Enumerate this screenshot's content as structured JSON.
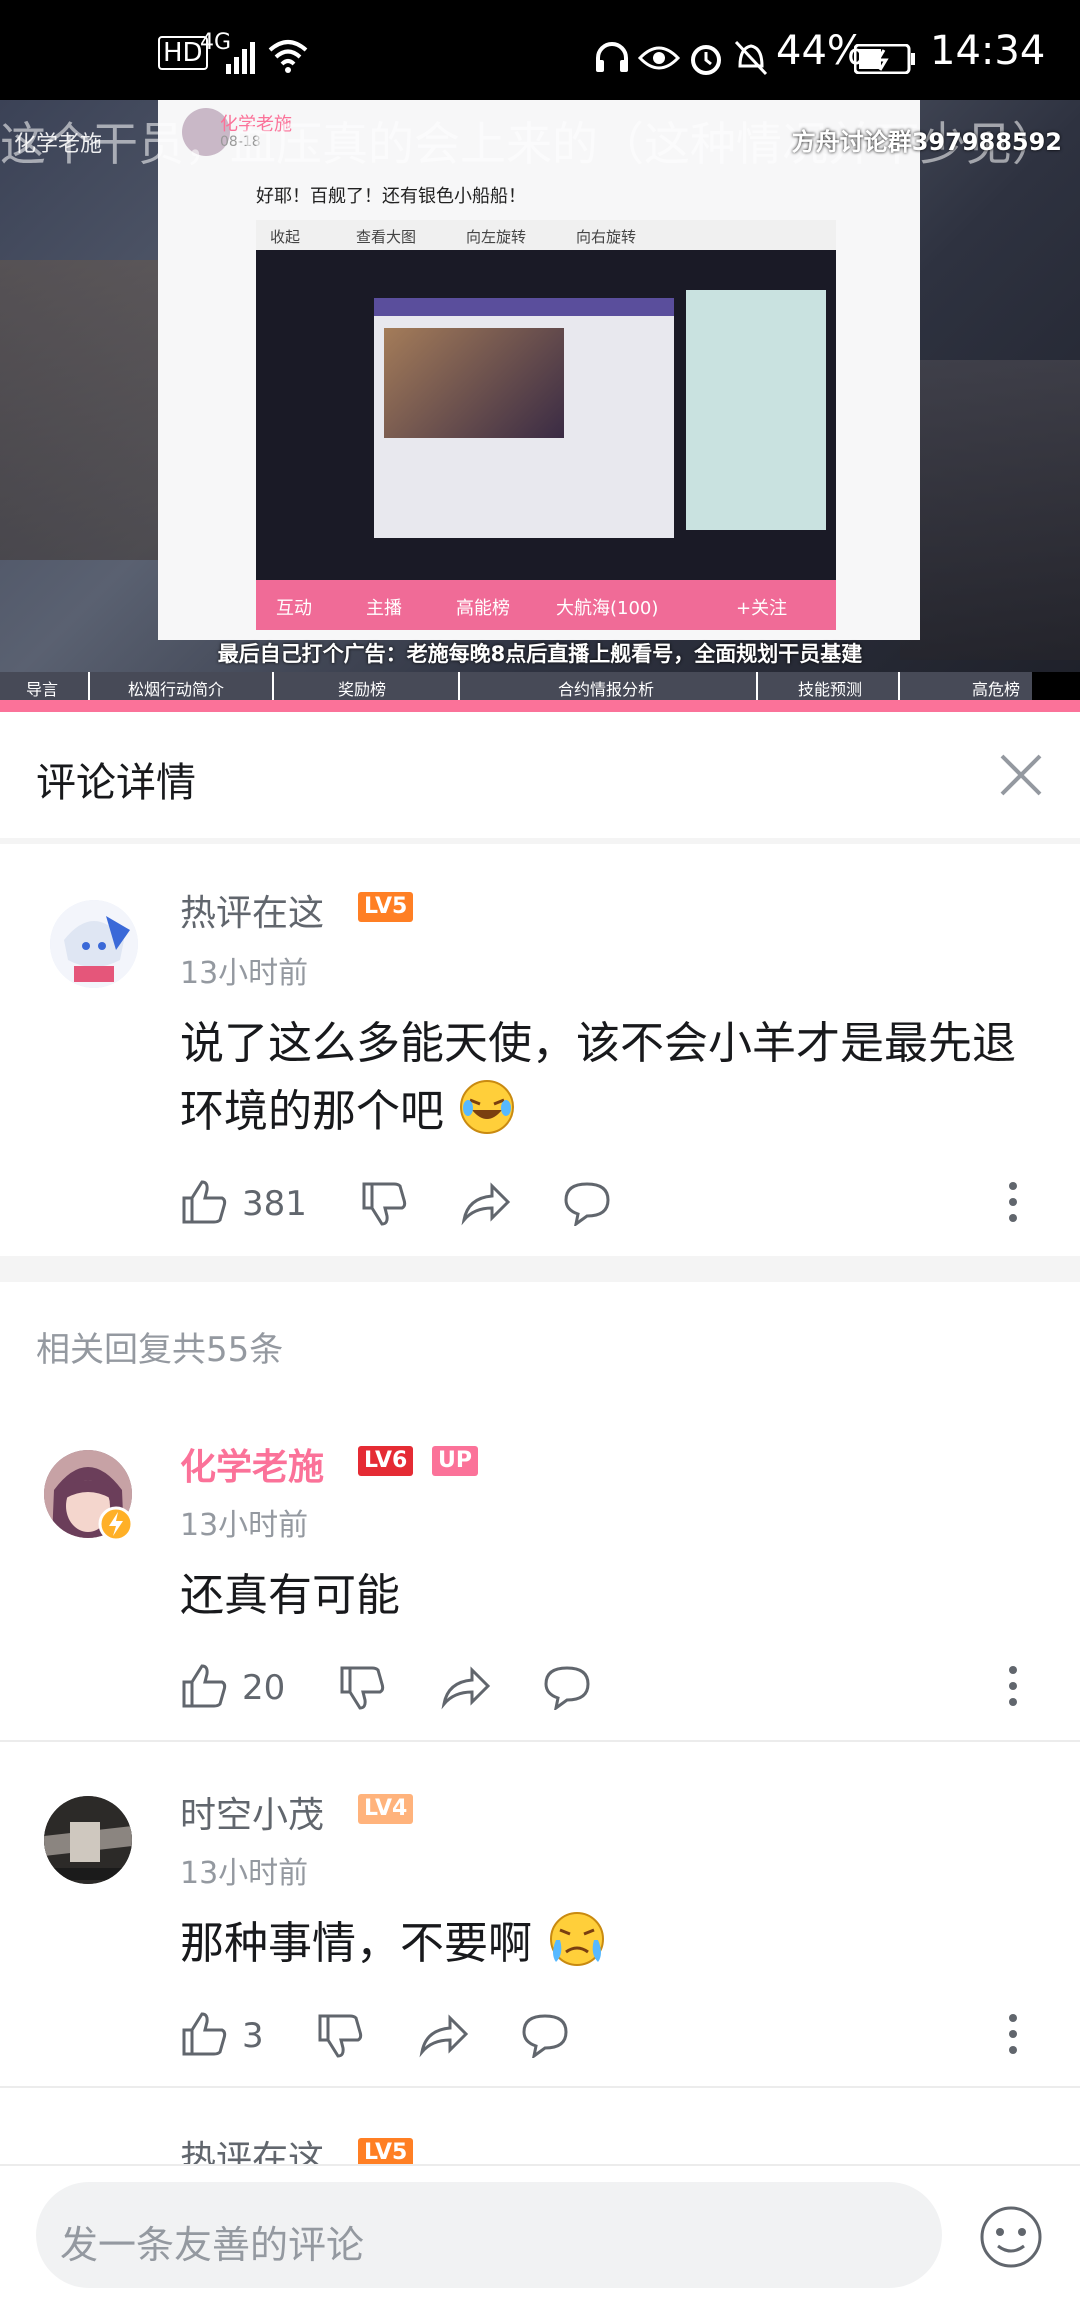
{
  "status_bar": {
    "hd": "HD",
    "network": "4G",
    "battery_percent": "44%",
    "time": "14:34"
  },
  "video": {
    "danmaku": "这个干员，血压真的会上来的（这种情况并不少见）",
    "watermark": "化学老施",
    "group_note": "方舟讨论群397988592",
    "post": {
      "author": "化学老施",
      "date": "08-18",
      "text": "好耶！百舰了！还有银色小船船！",
      "toolbar": [
        "收起",
        "查看大图",
        "向左旋转",
        "向右旋转"
      ],
      "tabs": [
        "互动",
        "主播",
        "高能榜",
        "大航海(100)"
      ],
      "follow": "+关注"
    },
    "ad_text": "最后自己打个广告：老施每晚8点后直播上舰看号，全面规划干员基建",
    "chapters": [
      "导言",
      "松烟行动简介",
      "奖励榜",
      "合约情报分析",
      "技能预测",
      "高危榜"
    ]
  },
  "header": {
    "title": "评论详情"
  },
  "main_comment": {
    "user": "热评在这",
    "level": "LV5",
    "time": "13小时前",
    "content": "说了这么多能天使，该不会小羊才是最先退环境的那个吧",
    "likes": "381"
  },
  "replies_count": "相关回复共55条",
  "replies": [
    {
      "user": "化学老施",
      "level": "LV6",
      "badge": "UP",
      "time": "13小时前",
      "content": "还真有可能",
      "likes": "20"
    },
    {
      "user": "时空小茂",
      "level": "LV4",
      "time": "13小时前",
      "content": "那种事情，不要啊",
      "likes": "3"
    },
    {
      "user": "热评在这",
      "level": "LV5"
    }
  ],
  "bottom": {
    "placeholder": "发一条友善的评论"
  },
  "colors": {
    "brand_pink": "#fb7299",
    "lv6_red": "#e52b34",
    "lv5_orange": "#ff7f24",
    "lv4_orange": "#ffb37c"
  }
}
